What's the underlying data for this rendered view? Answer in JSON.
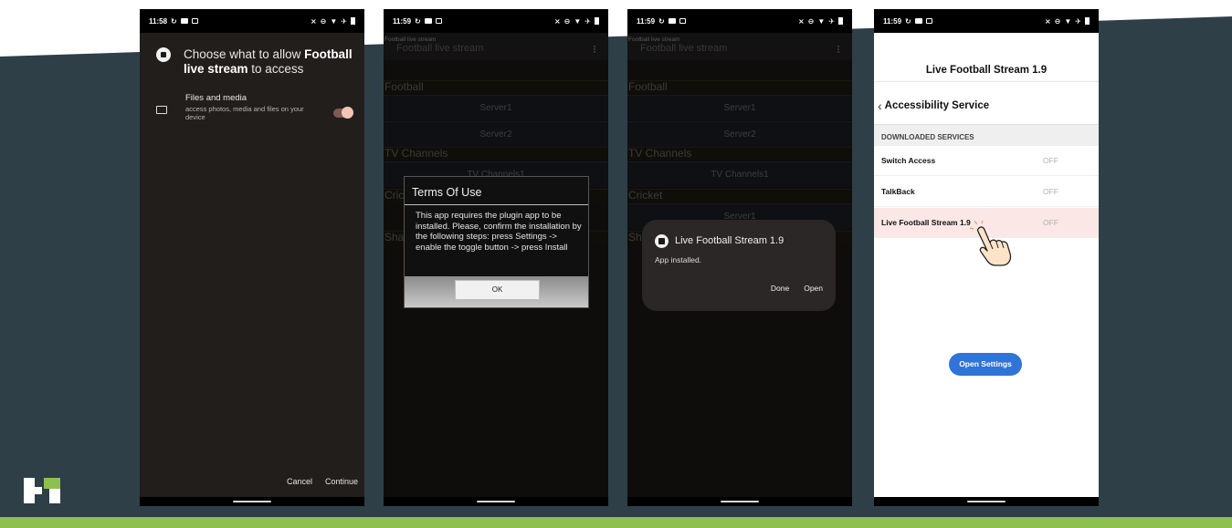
{
  "phone1": {
    "status_time": "11:58",
    "title_prefix": "Choose what to allow ",
    "title_app": "Football live stream",
    "title_suffix": " to access",
    "perm_name": "Files and media",
    "perm_desc": "access photos, media and files on your device",
    "cancel": "Cancel",
    "continue": "Continue"
  },
  "phone2": {
    "status_time": "11:59",
    "appbar_caption": "Football live stream",
    "appbar_title": "Football live stream",
    "sections": {
      "football": "Football",
      "tv": "TV Channels",
      "cricket": "Cric",
      "sha": "Sha"
    },
    "servers": {
      "s1": "Server1",
      "s2": "Server2",
      "tv1": "TV Channels1"
    },
    "dialog": {
      "title": "Terms Of Use",
      "body": "This app requires the plugin app to be installed. Please, confirm the installation by the following steps: press Settings -> enable the toggle button -> press Install",
      "ok": "OK"
    }
  },
  "phone3": {
    "status_time": "11:59",
    "appbar_caption": "Football live stream",
    "appbar_title": "Football live stream",
    "sections": {
      "football": "Football",
      "tv": "TV Channels",
      "cricket": "Cricket",
      "sha": "Sh"
    },
    "servers": {
      "s1": "Server1",
      "s2": "Server2",
      "tv1": "TV Channels1",
      "srv": "Server1"
    },
    "toast": {
      "title": "Live Football Stream 1.9",
      "message": "App installed.",
      "done": "Done",
      "open": "Open"
    }
  },
  "phone4": {
    "status_time": "11:59",
    "app_title": "Live Football Stream 1.9",
    "back_label": "Accessibility Service",
    "section_header": "DOWNLOADED SERVICES",
    "services": [
      {
        "name": "Switch Access",
        "state": "OFF"
      },
      {
        "name": "TalkBack",
        "state": "OFF"
      },
      {
        "name": "Live Football Stream 1.9",
        "state": "OFF"
      }
    ],
    "open_settings": "Open Settings"
  },
  "colors": {
    "background_slate": "#2e3f48",
    "accent_green": "#8dc04f",
    "button_blue": "#2f74d6",
    "selected_row": "#fbe7e6",
    "toggle_on": "#f4c4b6"
  },
  "icons": [
    "ball-icon",
    "folder-icon",
    "toggle-switch",
    "hand-pointer-icon",
    "brand-logo",
    "chevron-left-icon"
  ]
}
